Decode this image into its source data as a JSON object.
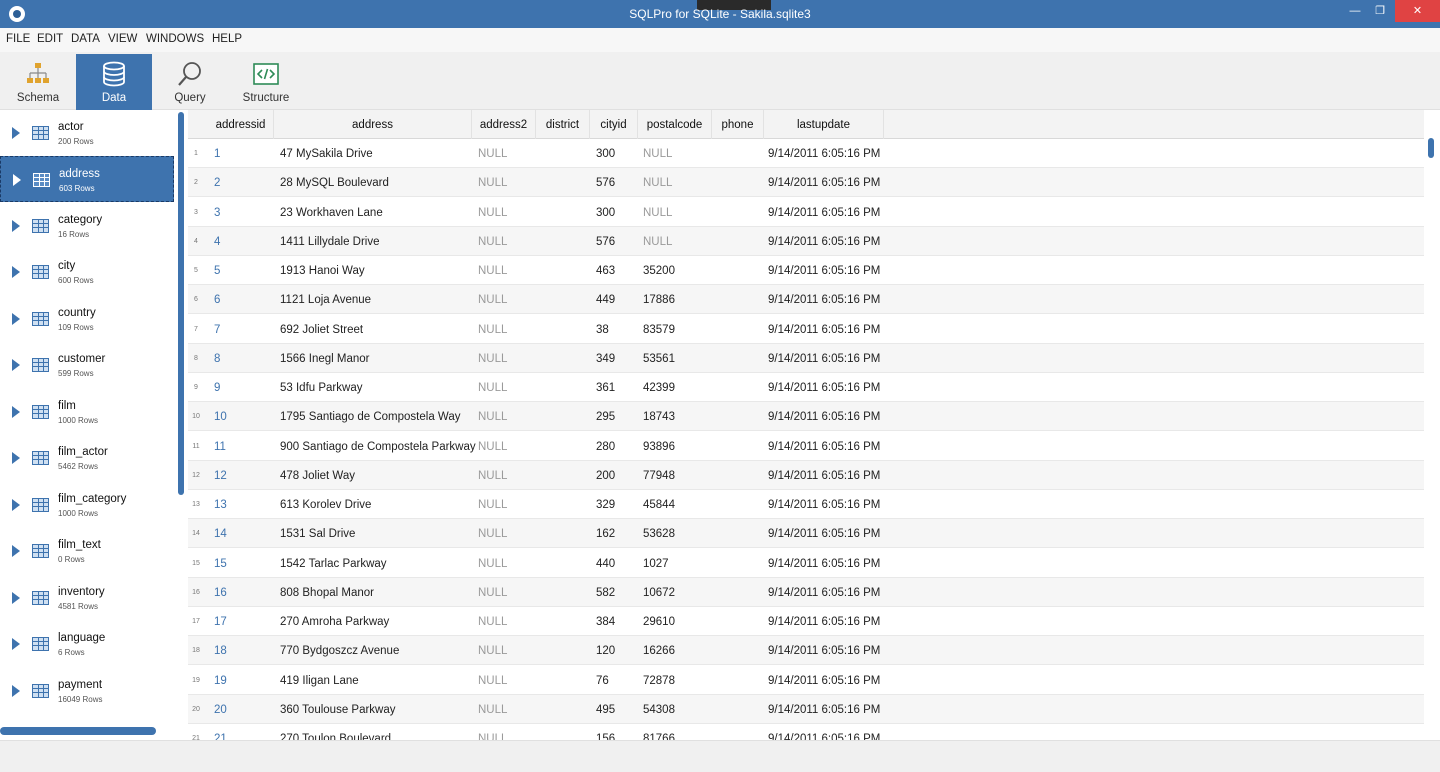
{
  "window": {
    "title": "SQLPro for SQLite - Sakila.sqlite3",
    "minimize_glyph": "—",
    "restore_glyph": "❐",
    "close_glyph": "✕"
  },
  "menu": [
    "FILE",
    "EDIT",
    "DATA",
    "VIEW",
    "WINDOWS",
    "HELP"
  ],
  "toolbar": {
    "active": "Data",
    "buttons": [
      {
        "label": "Schema",
        "icon": "schema-icon"
      },
      {
        "label": "Data",
        "icon": "database-icon"
      },
      {
        "label": "Query",
        "icon": "magnifier-icon"
      },
      {
        "label": "Structure",
        "icon": "code-icon"
      }
    ]
  },
  "sidebar": {
    "selected": "address",
    "tables": [
      {
        "name": "actor",
        "rows": "200 Rows"
      },
      {
        "name": "address",
        "rows": "603 Rows"
      },
      {
        "name": "category",
        "rows": "16 Rows"
      },
      {
        "name": "city",
        "rows": "600 Rows"
      },
      {
        "name": "country",
        "rows": "109 Rows"
      },
      {
        "name": "customer",
        "rows": "599 Rows"
      },
      {
        "name": "film",
        "rows": "1000 Rows"
      },
      {
        "name": "film_actor",
        "rows": "5462 Rows"
      },
      {
        "name": "film_category",
        "rows": "1000 Rows"
      },
      {
        "name": "film_text",
        "rows": "0 Rows"
      },
      {
        "name": "inventory",
        "rows": "4581 Rows"
      },
      {
        "name": "language",
        "rows": "6 Rows"
      },
      {
        "name": "payment",
        "rows": "16049 Rows"
      }
    ]
  },
  "grid": {
    "columns": [
      "addressid",
      "address",
      "address2",
      "district",
      "cityid",
      "postalcode",
      "phone",
      "lastupdate"
    ],
    "rows": [
      {
        "n": "1",
        "cells": [
          "1",
          "47 MySakila Drive",
          "NULL",
          "",
          "300",
          "NULL",
          "",
          "9/14/2011 6:05:16 PM"
        ]
      },
      {
        "n": "2",
        "cells": [
          "2",
          "28 MySQL Boulevard",
          "NULL",
          "",
          "576",
          "NULL",
          "",
          "9/14/2011 6:05:16 PM"
        ]
      },
      {
        "n": "3",
        "cells": [
          "3",
          "23 Workhaven Lane",
          "NULL",
          "",
          "300",
          "NULL",
          "",
          "9/14/2011 6:05:16 PM"
        ]
      },
      {
        "n": "4",
        "cells": [
          "4",
          "1411 Lillydale Drive",
          "NULL",
          "",
          "576",
          "NULL",
          "",
          "9/14/2011 6:05:16 PM"
        ]
      },
      {
        "n": "5",
        "cells": [
          "5",
          "1913 Hanoi Way",
          "NULL",
          "",
          "463",
          "35200",
          "",
          "9/14/2011 6:05:16 PM"
        ]
      },
      {
        "n": "6",
        "cells": [
          "6",
          "1121 Loja Avenue",
          "NULL",
          "",
          "449",
          "17886",
          "",
          "9/14/2011 6:05:16 PM"
        ]
      },
      {
        "n": "7",
        "cells": [
          "7",
          "692 Joliet Street",
          "NULL",
          "",
          "38",
          "83579",
          "",
          "9/14/2011 6:05:16 PM"
        ]
      },
      {
        "n": "8",
        "cells": [
          "8",
          "1566 Inegl Manor",
          "NULL",
          "",
          "349",
          "53561",
          "",
          "9/14/2011 6:05:16 PM"
        ]
      },
      {
        "n": "9",
        "cells": [
          "9",
          "53 Idfu Parkway",
          "NULL",
          "",
          "361",
          "42399",
          "",
          "9/14/2011 6:05:16 PM"
        ]
      },
      {
        "n": "10",
        "cells": [
          "10",
          "1795 Santiago de Compostela Way",
          "NULL",
          "",
          "295",
          "18743",
          "",
          "9/14/2011 6:05:16 PM"
        ]
      },
      {
        "n": "11",
        "cells": [
          "11",
          "900 Santiago de Compostela Parkway",
          "NULL",
          "",
          "280",
          "93896",
          "",
          "9/14/2011 6:05:16 PM"
        ]
      },
      {
        "n": "12",
        "cells": [
          "12",
          "478 Joliet Way",
          "NULL",
          "",
          "200",
          "77948",
          "",
          "9/14/2011 6:05:16 PM"
        ]
      },
      {
        "n": "13",
        "cells": [
          "13",
          "613 Korolev Drive",
          "NULL",
          "",
          "329",
          "45844",
          "",
          "9/14/2011 6:05:16 PM"
        ]
      },
      {
        "n": "14",
        "cells": [
          "14",
          "1531 Sal Drive",
          "NULL",
          "",
          "162",
          "53628",
          "",
          "9/14/2011 6:05:16 PM"
        ]
      },
      {
        "n": "15",
        "cells": [
          "15",
          "1542 Tarlac Parkway",
          "NULL",
          "",
          "440",
          "1027",
          "",
          "9/14/2011 6:05:16 PM"
        ]
      },
      {
        "n": "16",
        "cells": [
          "16",
          "808 Bhopal Manor",
          "NULL",
          "",
          "582",
          "10672",
          "",
          "9/14/2011 6:05:16 PM"
        ]
      },
      {
        "n": "17",
        "cells": [
          "17",
          "270 Amroha Parkway",
          "NULL",
          "",
          "384",
          "29610",
          "",
          "9/14/2011 6:05:16 PM"
        ]
      },
      {
        "n": "18",
        "cells": [
          "18",
          "770 Bydgoszcz Avenue",
          "NULL",
          "",
          "120",
          "16266",
          "",
          "9/14/2011 6:05:16 PM"
        ]
      },
      {
        "n": "19",
        "cells": [
          "19",
          "419 Iligan Lane",
          "NULL",
          "",
          "76",
          "72878",
          "",
          "9/14/2011 6:05:16 PM"
        ]
      },
      {
        "n": "20",
        "cells": [
          "20",
          "360 Toulouse Parkway",
          "NULL",
          "",
          "495",
          "54308",
          "",
          "9/14/2011 6:05:16 PM"
        ]
      },
      {
        "n": "21",
        "cells": [
          "21",
          "270 Toulon Boulevard",
          "NULL",
          "",
          "156",
          "81766",
          "",
          "9/14/2011 6:05:16 PM"
        ]
      }
    ]
  },
  "colors": {
    "accent": "#3e73ae",
    "close": "#e04343",
    "null_text": "#9a9a9a"
  }
}
